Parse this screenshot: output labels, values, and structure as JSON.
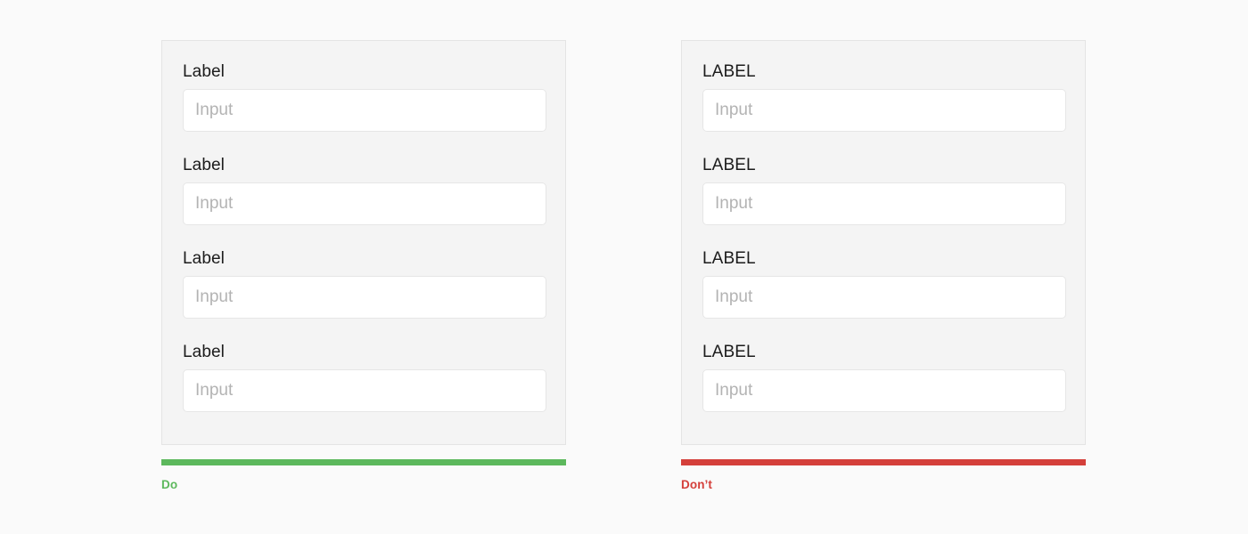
{
  "page": {
    "background_color": "#fafafa",
    "panel_background_color": "#f4f4f4",
    "panel_border_color": "#e4e4e4",
    "input_background_color": "#ffffff",
    "input_border_color": "#e6e6e6",
    "label_color": "#1b1b1b",
    "placeholder_color": "#b3b3b3"
  },
  "examples": [
    {
      "variant": "do",
      "accent_color": "#5cb85c",
      "caption": "Do",
      "fields": [
        {
          "label": "Label",
          "value": "",
          "placeholder": "Input"
        },
        {
          "label": "Label",
          "value": "",
          "placeholder": "Input"
        },
        {
          "label": "Label",
          "value": "",
          "placeholder": "Input"
        },
        {
          "label": "Label",
          "value": "",
          "placeholder": "Input"
        }
      ]
    },
    {
      "variant": "dont",
      "accent_color": "#d43f3a",
      "caption": "Don’t",
      "fields": [
        {
          "label": "LABEL",
          "value": "",
          "placeholder": "Input"
        },
        {
          "label": "LABEL",
          "value": "",
          "placeholder": "Input"
        },
        {
          "label": "LABEL",
          "value": "",
          "placeholder": "Input"
        },
        {
          "label": "LABEL",
          "value": "",
          "placeholder": "Input"
        }
      ]
    }
  ]
}
